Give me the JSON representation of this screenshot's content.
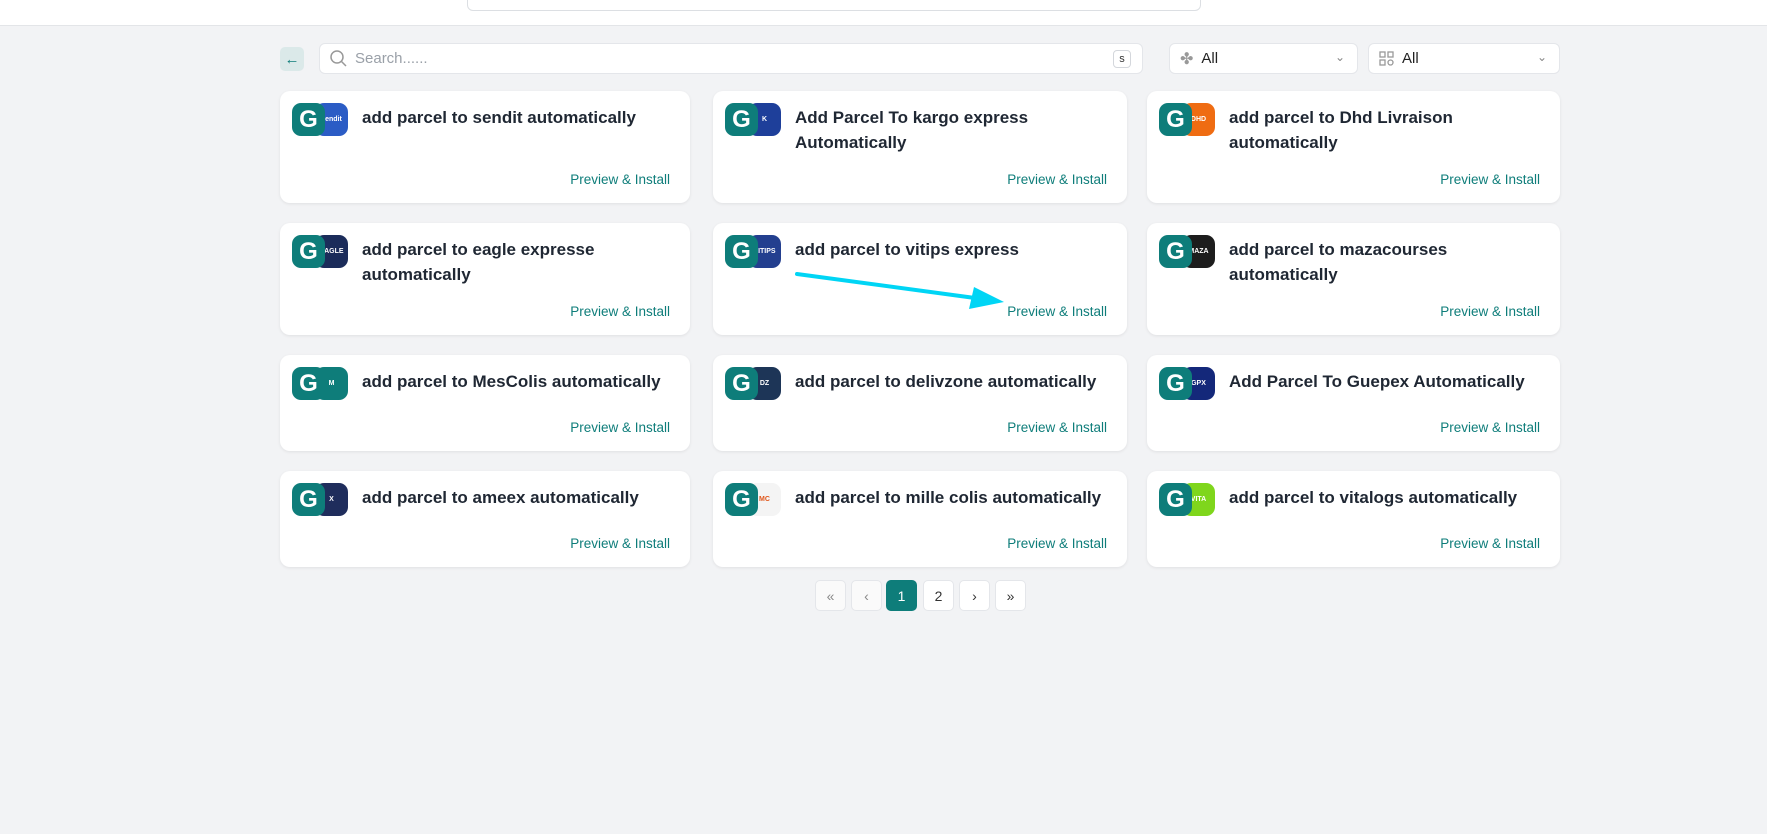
{
  "search": {
    "placeholder": "Search......",
    "shortcut": "s"
  },
  "filters": [
    {
      "icon": "puzzle-icon",
      "value": "All"
    },
    {
      "icon": "grid-icon",
      "value": "All"
    }
  ],
  "cards": [
    {
      "title": "add parcel to sendit automatically",
      "brand": "sendit",
      "color": "#2b5cc5",
      "action": "Preview & Install"
    },
    {
      "title": "Add Parcel To kargo express Automatically",
      "brand": "K",
      "color": "#1e3f9a",
      "action": "Preview & Install"
    },
    {
      "title": "add parcel to Dhd Livraison automatically",
      "brand": "DHD",
      "color": "#ef6c12",
      "action": "Preview & Install"
    },
    {
      "title": "add parcel to eagle expresse automatically",
      "brand": "EAGLE",
      "color": "#1b2c5a",
      "action": "Preview & Install"
    },
    {
      "title": "add parcel to vitips express",
      "brand": "VITIPS",
      "color": "#233f8f",
      "action": "Preview & Install"
    },
    {
      "title": "add parcel to mazacourses automatically",
      "brand": "MAZA",
      "color": "#1d1d1d",
      "action": "Preview & Install"
    },
    {
      "title": "add parcel to MesColis automatically",
      "brand": "M",
      "color": "#0e7d7a",
      "action": "Preview & Install"
    },
    {
      "title": "add parcel to delivzone automatically",
      "brand": "DZ",
      "color": "#1d3557",
      "action": "Preview & Install"
    },
    {
      "title": "Add Parcel To Guepex Automatically",
      "brand": "GPX",
      "color": "#14287a",
      "action": "Preview & Install"
    },
    {
      "title": "add parcel to ameex automatically",
      "brand": "X",
      "color": "#1f2d5c",
      "action": "Preview & Install"
    },
    {
      "title": "add parcel to mille colis automatically",
      "brand": "MC",
      "color": "#f4f4f4",
      "action": "Preview & Install"
    },
    {
      "title": "add parcel to vitalogs automatically",
      "brand": "VITA",
      "color": "#7fd61c",
      "action": "Preview & Install"
    }
  ],
  "pagination": {
    "first": "«",
    "prev": "‹",
    "pages": [
      "1",
      "2"
    ],
    "current": "1",
    "next": "›",
    "last": "»"
  },
  "colors": {
    "accent": "#0e7d7a",
    "annotation_arrow": "#00d5f5"
  }
}
